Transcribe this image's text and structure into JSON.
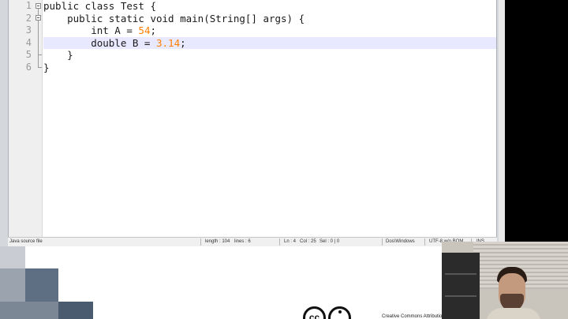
{
  "editor": {
    "line_numbers": [
      "1",
      "2",
      "3",
      "4",
      "5",
      "6"
    ],
    "lines": [
      {
        "tokens": [
          {
            "t": "public class Test {",
            "c": "kw"
          }
        ]
      },
      {
        "tokens": [
          {
            "t": "    public static void main(String[] args) {",
            "c": "kw"
          }
        ]
      },
      {
        "tokens": [
          {
            "t": "        int A = ",
            "c": "kw"
          },
          {
            "t": "54",
            "c": "num"
          },
          {
            "t": ";",
            "c": "op"
          }
        ]
      },
      {
        "tokens": [
          {
            "t": "        double B = ",
            "c": "kw"
          },
          {
            "t": "3.14",
            "c": "num"
          },
          {
            "t": ";",
            "c": "op"
          }
        ]
      },
      {
        "tokens": [
          {
            "t": "    }",
            "c": "kw"
          }
        ]
      },
      {
        "tokens": [
          {
            "t": "}",
            "c": "kw"
          }
        ]
      }
    ],
    "current_line": 4
  },
  "status_bar": {
    "file_type": "Java source file",
    "length": "length : 104",
    "lines": "lines : 6",
    "ln": "Ln : 4",
    "col": "Col : 25",
    "sel": "Sel : 0 | 0",
    "eol": "Dos\\Windows",
    "encoding": "UTF-8 w/o BOM",
    "mode": "INS"
  },
  "slide": {
    "license_text": "Creative Commons Attribution",
    "cc_mark": "cc"
  },
  "colors": {
    "number": "#ff8000",
    "current_line_bg": "#e8e8ff",
    "gutter_bg": "#efefef"
  }
}
